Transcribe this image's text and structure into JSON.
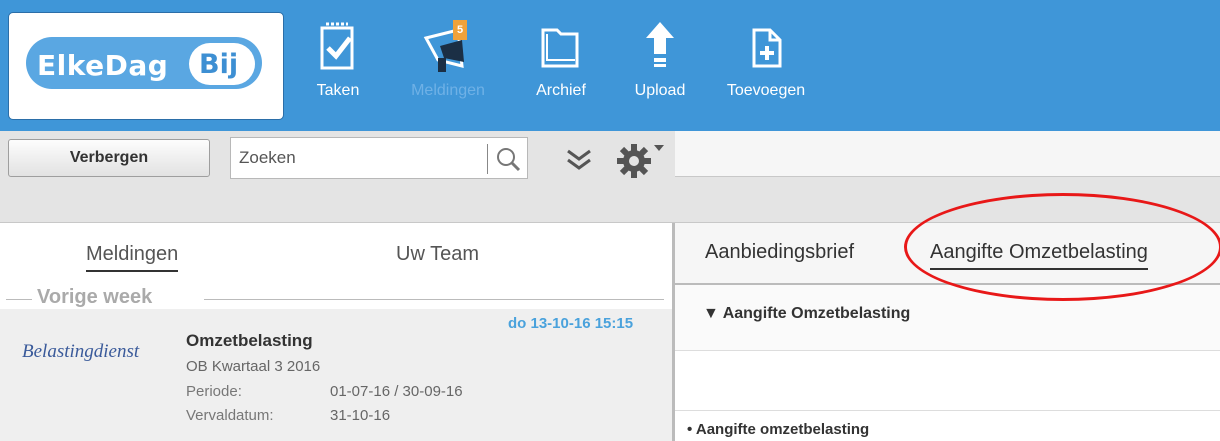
{
  "logo": {
    "part1": "ElkeDag",
    "part2": "Bij"
  },
  "toolbar_icons": [
    {
      "label": "Taken",
      "icon": "tasks-icon",
      "active": true
    },
    {
      "label": "Meldingen",
      "icon": "megaphone-icon",
      "active": false,
      "badge": "5"
    },
    {
      "label": "Archief",
      "icon": "folder-icon",
      "active": true
    },
    {
      "label": "Upload",
      "icon": "upload-arrow-icon",
      "active": true
    },
    {
      "label": "Toevoegen",
      "icon": "add-document-icon",
      "active": true
    }
  ],
  "actions": {
    "hide_label": "Verbergen",
    "search_placeholder": "Zoeken"
  },
  "left": {
    "tabs": [
      "Meldingen",
      "Uw Team"
    ],
    "section": "Vorige week",
    "notification": {
      "date": "do 13-10-16 15:15",
      "sender": "Belastingdienst",
      "title": "Omzetbelasting",
      "subtitle": "OB Kwartaal 3 2016",
      "fields": [
        {
          "key": "Periode:",
          "value": "01-07-16 / 30-09-16"
        },
        {
          "key": "Vervaldatum:",
          "value": "31-10-16"
        }
      ]
    }
  },
  "right": {
    "tabs": [
      "Aanbiedingsbrief",
      "Aangifte Omzetbelasting"
    ],
    "accordion_title": "▼ Aangifte Omzetbelasting",
    "bullet": "• Aangifte omzetbelasting"
  },
  "colors": {
    "header": "#3f96d8",
    "highlight": "#e81818",
    "date": "#4aa2dc"
  }
}
